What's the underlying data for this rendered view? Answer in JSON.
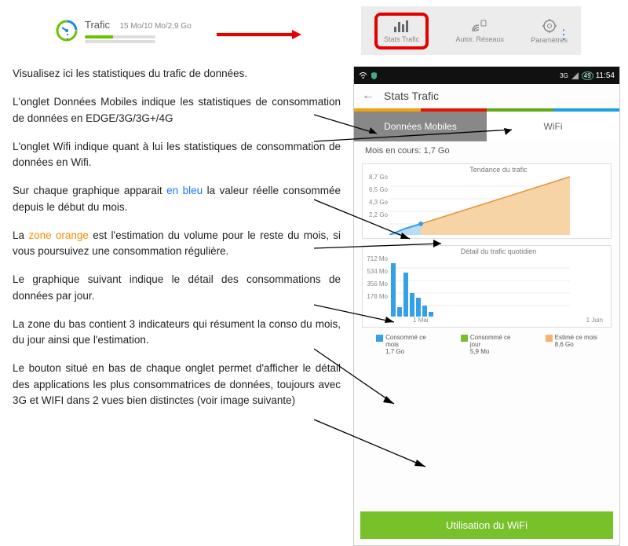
{
  "topbar": {
    "trafic_label": "Trafic",
    "trafic_values": "15 Mo/10 Mo/2,9 Go",
    "tabs": {
      "stats": "Stats Trafic",
      "autor": "Autor. Réseaux",
      "param": "Paramètres"
    }
  },
  "paragraphs": {
    "p1": "Visualisez ici les statistiques du trafic de données.",
    "p2": "L'onglet Données Mobiles indique les statistiques de consommation de données en EDGE/3G/3G+/4G",
    "p3": "L'onglet Wifi indique quant à lui les statistiques de consommation de données en Wifi.",
    "p4a": "Sur chaque graphique apparait ",
    "p4b": "en bleu",
    "p4c": " la valeur réelle consommée depuis le début du mois.",
    "p5a": "La ",
    "p5b": "zone orange",
    "p5c": " est l'estimation du volume pour le reste du mois, si vous poursuivez une consommation régulière.",
    "p6": "Le graphique suivant indique le détail des consommations de données par jour.",
    "p7": "La zone du bas contient 3 indicateurs qui résument la conso du mois, du jour ainsi que l'estimation.",
    "p8": "Le bouton situé en bas de chaque onglet permet d'afficher le détail des applications les plus consommatrices de données, toujours avec 3G et WIFI dans 2 vues bien distinctes (voir image suivante)"
  },
  "phone": {
    "time": "11:54",
    "battery": "49",
    "title": "Stats Trafic",
    "tab_mobile": "Données Mobiles",
    "tab_wifi": "WiFi",
    "mois": "Mois en cours: 1,7 Go",
    "trend_title": "Tendance du trafic",
    "daily_title": "Détail du trafic quotidien",
    "trend_y": {
      "a": "8,7 Go",
      "b": "6,5 Go",
      "c": "4,3 Go",
      "d": "2,2 Go"
    },
    "daily_y": {
      "a": "712 Mo",
      "b": "534 Mo",
      "c": "356 Mo",
      "d": "178 Mo"
    },
    "x1": "1 Mai",
    "x2": "1 Juin",
    "legend": {
      "l1a": "Consommé ce",
      "l1b": "mois",
      "l1v": "1,7 Go",
      "l2a": "Consommé ce",
      "l2b": "jour",
      "l2v": "5,9 Mo",
      "l3a": "Estimé ce mois",
      "l3v": "8,6 Go"
    },
    "wifi_btn": "Utilisation du WiFi"
  },
  "colors": {
    "blue": "#33a0e8",
    "green": "#77c12a",
    "orange": "#f6b26b",
    "red": "#e30000"
  },
  "chart_data": [
    {
      "type": "area",
      "title": "Tendance du trafic",
      "x": [
        "1 Mai",
        "1 Juin"
      ],
      "ylabel": "",
      "ylim": [
        0,
        8.7
      ],
      "y_ticks": [
        2.2,
        4.3,
        6.5,
        8.7
      ],
      "y_unit": "Go",
      "series": [
        {
          "name": "Consommé (bleu)",
          "color": "#33a0e8",
          "days": [
            1,
            2,
            3,
            4,
            5,
            6
          ],
          "values": [
            0,
            0.4,
            0.9,
            1.3,
            1.6,
            1.7
          ]
        },
        {
          "name": "Estimation (orange)",
          "color": "#f6b26b",
          "days": [
            6,
            31
          ],
          "values": [
            1.7,
            8.6
          ]
        }
      ]
    },
    {
      "type": "bar",
      "title": "Détail du trafic quotidien",
      "xlabel": "jour",
      "ylabel": "",
      "ylim": [
        0,
        712
      ],
      "y_ticks": [
        178,
        356,
        534,
        712
      ],
      "y_unit": "Mo",
      "categories": [
        "1",
        "2",
        "3",
        "4",
        "5",
        "6",
        "7"
      ],
      "values": [
        712,
        130,
        580,
        320,
        250,
        150,
        60
      ]
    }
  ]
}
